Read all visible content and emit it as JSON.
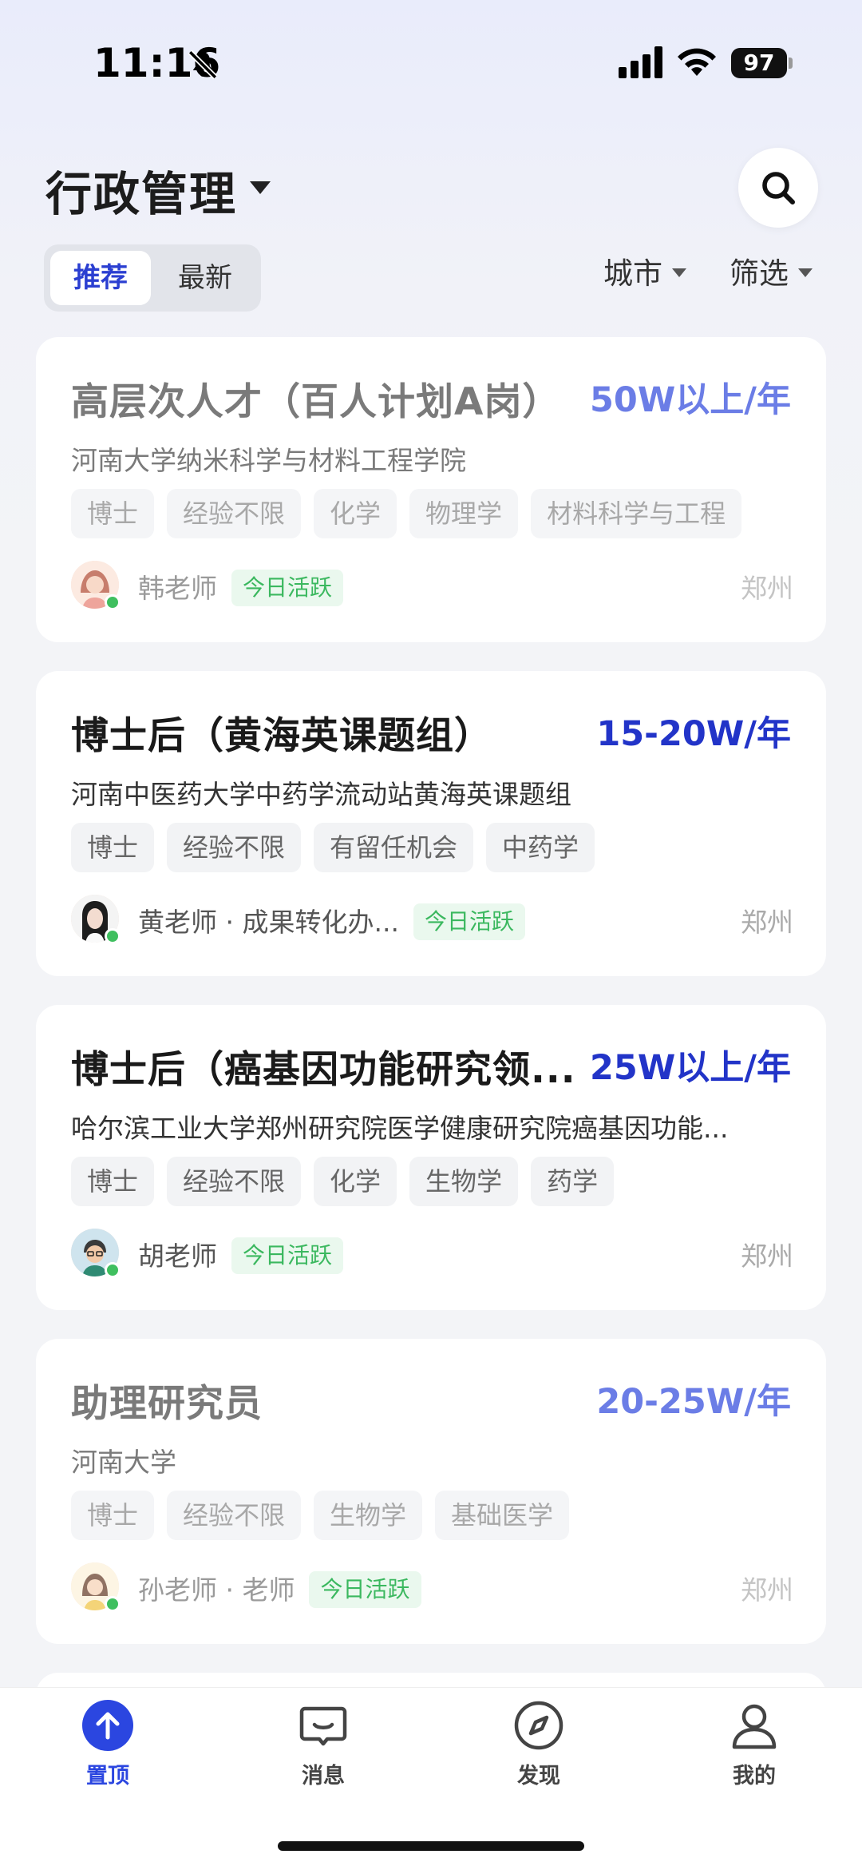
{
  "status_bar": {
    "time": "11:16",
    "battery": "97",
    "icons": [
      "bell-muted-icon",
      "signal-icon",
      "wifi-icon",
      "battery-icon"
    ]
  },
  "header": {
    "title": "行政管理",
    "segments": {
      "active": "推荐",
      "inactive": "最新"
    },
    "filters": {
      "city": "城市",
      "screen": "筛选"
    }
  },
  "jobs": [
    {
      "title": "高层次人才（百人计划A岗）",
      "salary": "50W以上/年",
      "org": "河南大学纳米科学与材料工程学院",
      "tags": [
        "博士",
        "经验不限",
        "化学",
        "物理学",
        "材料科学与工程"
      ],
      "person": "韩老师",
      "active": "今日活跃",
      "city": "郑州"
    },
    {
      "title": "博士后（黄海英课题组）",
      "salary": "15-20W/年",
      "org": "河南中医药大学中药学流动站黄海英课题组",
      "tags": [
        "博士",
        "经验不限",
        "有留任机会",
        "中药学"
      ],
      "person": "黄老师 · 成果转化办...",
      "active": "今日活跃",
      "city": "郑州"
    },
    {
      "title": "博士后（癌基因功能研究领...",
      "salary": "25W以上/年",
      "org": "哈尔滨工业大学郑州研究院医学健康研究院癌基因功能...",
      "tags": [
        "博士",
        "经验不限",
        "化学",
        "生物学",
        "药学"
      ],
      "person": "胡老师",
      "active": "今日活跃",
      "city": "郑州"
    },
    {
      "title": "助理研究员",
      "salary": "20-25W/年",
      "org": "河南大学",
      "tags": [
        "博士",
        "经验不限",
        "生物学",
        "基础医学"
      ],
      "person": "孙老师 · 老师",
      "active": "今日活跃",
      "city": "郑州"
    }
  ],
  "tabbar": {
    "top": "置顶",
    "messages": "消息",
    "discover": "发现",
    "mine": "我的"
  },
  "colors": {
    "accent": "#2b46e0",
    "salary": "#2234c8",
    "active_green": "#3bb85f"
  }
}
